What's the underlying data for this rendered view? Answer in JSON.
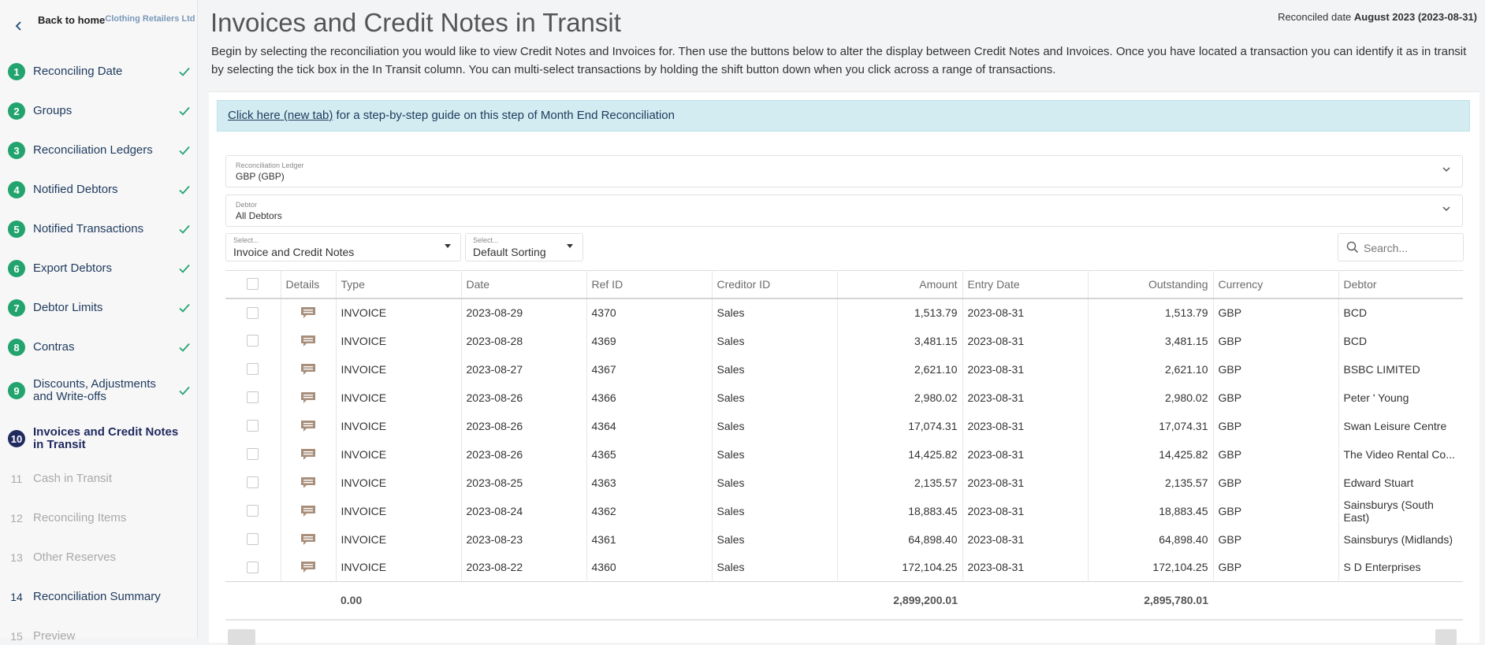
{
  "sidebar": {
    "back_label": "Back to home",
    "company": "Clothing Retailers Ltd",
    "steps": [
      {
        "num": "1",
        "label": "Reconciling Date",
        "done": true
      },
      {
        "num": "2",
        "label": "Groups",
        "done": true
      },
      {
        "num": "3",
        "label": "Reconciliation Ledgers",
        "done": true
      },
      {
        "num": "4",
        "label": "Notified Debtors",
        "done": true
      },
      {
        "num": "5",
        "label": "Notified Transactions",
        "done": true
      },
      {
        "num": "6",
        "label": "Export Debtors",
        "done": true
      },
      {
        "num": "7",
        "label": "Debtor Limits",
        "done": true
      },
      {
        "num": "8",
        "label": "Contras",
        "done": true
      },
      {
        "num": "9",
        "label": "Discounts, Adjustments and Write-offs",
        "done": true
      },
      {
        "num": "10",
        "label": "Invoices and Credit Notes in Transit",
        "current": true
      },
      {
        "num": "11",
        "label": "Cash in Transit",
        "disabled": true
      },
      {
        "num": "12",
        "label": "Reconciling Items",
        "disabled": true
      },
      {
        "num": "13",
        "label": "Other Reserves",
        "disabled": true
      },
      {
        "num": "14",
        "label": "Reconciliation Summary"
      },
      {
        "num": "15",
        "label": "Preview",
        "disabled": true
      }
    ]
  },
  "header": {
    "title": "Invoices and Credit Notes in Transit",
    "reconciled_prefix": "Reconciled date",
    "reconciled_value": "August 2023 (2023-08-31)",
    "intro": "Begin by selecting the reconciliation you would like to view Credit Notes and Invoices for. Then use the buttons below to alter the display between Credit Notes and Invoices. Once you have located a transaction you can identify it as in transit by selecting the tick box in the In Transit column. You can multi-select transactions by holding the shift button down when you click across a range of transactions."
  },
  "guide": {
    "link": "Click here (new tab)",
    "text": " for a step-by-step guide on this step of Month End Reconciliation"
  },
  "filters": {
    "ledger_caption": "Reconciliation Ledger",
    "ledger_value": "GBP (GBP)",
    "debtor_caption": "Debtor",
    "debtor_value": "All Debtors",
    "type_caption": "Select...",
    "type_value": "Invoice and Credit Notes",
    "sort_caption": "Select...",
    "sort_value": "Default Sorting",
    "search_placeholder": "Search..."
  },
  "table": {
    "columns": [
      "Details",
      "Type",
      "Date",
      "Ref ID",
      "Creditor ID",
      "Amount",
      "Entry Date",
      "Outstanding",
      "Currency",
      "Debtor"
    ],
    "rows": [
      {
        "type": "INVOICE",
        "date": "2023-08-29",
        "ref": "4370",
        "creditor": "Sales",
        "amount": "1,513.79",
        "entry": "2023-08-31",
        "outstanding": "1,513.79",
        "currency": "GBP",
        "debtor": "BCD"
      },
      {
        "type": "INVOICE",
        "date": "2023-08-28",
        "ref": "4369",
        "creditor": "Sales",
        "amount": "3,481.15",
        "entry": "2023-08-31",
        "outstanding": "3,481.15",
        "currency": "GBP",
        "debtor": "BCD"
      },
      {
        "type": "INVOICE",
        "date": "2023-08-27",
        "ref": "4367",
        "creditor": "Sales",
        "amount": "2,621.10",
        "entry": "2023-08-31",
        "outstanding": "2,621.10",
        "currency": "GBP",
        "debtor": "BSBC LIMITED"
      },
      {
        "type": "INVOICE",
        "date": "2023-08-26",
        "ref": "4366",
        "creditor": "Sales",
        "amount": "2,980.02",
        "entry": "2023-08-31",
        "outstanding": "2,980.02",
        "currency": "GBP",
        "debtor": "Peter ' Young"
      },
      {
        "type": "INVOICE",
        "date": "2023-08-26",
        "ref": "4364",
        "creditor": "Sales",
        "amount": "17,074.31",
        "entry": "2023-08-31",
        "outstanding": "17,074.31",
        "currency": "GBP",
        "debtor": "Swan Leisure Centre"
      },
      {
        "type": "INVOICE",
        "date": "2023-08-26",
        "ref": "4365",
        "creditor": "Sales",
        "amount": "14,425.82",
        "entry": "2023-08-31",
        "outstanding": "14,425.82",
        "currency": "GBP",
        "debtor": "The Video Rental Co..."
      },
      {
        "type": "INVOICE",
        "date": "2023-08-25",
        "ref": "4363",
        "creditor": "Sales",
        "amount": "2,135.57",
        "entry": "2023-08-31",
        "outstanding": "2,135.57",
        "currency": "GBP",
        "debtor": "Edward Stuart"
      },
      {
        "type": "INVOICE",
        "date": "2023-08-24",
        "ref": "4362",
        "creditor": "Sales",
        "amount": "18,883.45",
        "entry": "2023-08-31",
        "outstanding": "18,883.45",
        "currency": "GBP",
        "debtor": "Sainsburys (South East)"
      },
      {
        "type": "INVOICE",
        "date": "2023-08-23",
        "ref": "4361",
        "creditor": "Sales",
        "amount": "64,898.40",
        "entry": "2023-08-31",
        "outstanding": "64,898.40",
        "currency": "GBP",
        "debtor": "Sainsburys (Midlands)"
      },
      {
        "type": "INVOICE",
        "date": "2023-08-22",
        "ref": "4360",
        "creditor": "Sales",
        "amount": "172,104.25",
        "entry": "2023-08-31",
        "outstanding": "172,104.25",
        "currency": "GBP",
        "debtor": "S D Enterprises"
      }
    ],
    "totals": {
      "in_transit": "0.00",
      "amount": "2,899,200.01",
      "outstanding": "2,895,780.01"
    }
  },
  "colors": {
    "done": "#23a46e",
    "current": "#1f2a5e",
    "guide_bg": "#d3ecf2",
    "detail_icon": "#a88f7c"
  },
  "icons": {
    "back": "chevron-left-icon",
    "done": "check-icon",
    "details": "comment-icon",
    "search": "search-icon",
    "select": "chevron-down-icon"
  }
}
